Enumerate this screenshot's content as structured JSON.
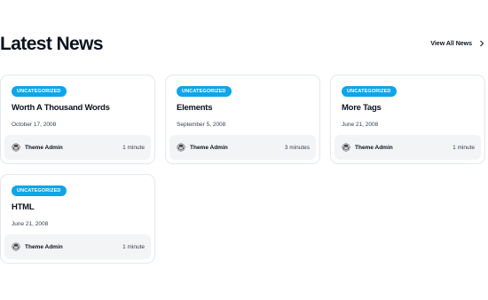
{
  "section": {
    "title": "Latest News",
    "view_all_label": "View All News"
  },
  "posts": [
    {
      "category": "UNCATEGORIZED",
      "title": "Worth A Thousand Words",
      "date": "October 17, 2008",
      "author": "Theme Admin",
      "read_time": "1 minute"
    },
    {
      "category": "UNCATEGORIZED",
      "title": "Elements",
      "date": "September 5, 2008",
      "author": "Theme Admin",
      "read_time": "3 minutes"
    },
    {
      "category": "UNCATEGORIZED",
      "title": "More Tags",
      "date": "June 21, 2008",
      "author": "Theme Admin",
      "read_time": "1 minute"
    },
    {
      "category": "UNCATEGORIZED",
      "title": "HTML",
      "date": "June 21, 2008",
      "author": "Theme Admin",
      "read_time": "1 minute"
    }
  ],
  "icons": {
    "author": "wordpress-icon",
    "view_all": "chevron-right-icon"
  },
  "colors": {
    "badge": "#0ea5e9",
    "text": "#0b1220",
    "footer_bg": "#f3f4f6",
    "border": "#e2e8f0"
  }
}
